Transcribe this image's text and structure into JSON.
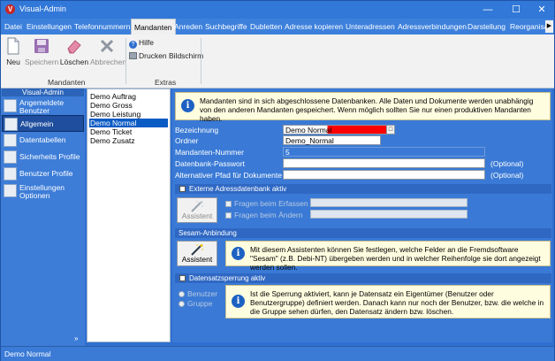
{
  "window": {
    "title": "Visual-Admin"
  },
  "menu": {
    "items": [
      "Datei",
      "Einstellungen",
      "Telefonnummern",
      "Mandanten",
      "Anreden",
      "Suchbegriffe",
      "Dubletten",
      "Adresse kopieren",
      "Unteradressen",
      "Adressverbindungen",
      "Darstellung",
      "Reorganisa"
    ],
    "active": "Mandanten"
  },
  "ribbon": {
    "neu": "Neu",
    "speichern": "Speichern",
    "loeschen": "Löschen",
    "abbrechen": "Abbrechen",
    "group_mandanten": "Mandanten",
    "hilfe": "Hilfe",
    "drucken": "Drucken Bildschirm",
    "group_extras": "Extras"
  },
  "sidebar": {
    "header": "Visual-Admin",
    "items": [
      {
        "label": "Angemeldete Benutzer",
        "icon": "users-icon"
      },
      {
        "label": "Allgemein",
        "icon": "general-icon"
      },
      {
        "label": "Datentabellen",
        "icon": "table-icon"
      },
      {
        "label": "Sicherheits Profile",
        "icon": "security-icon"
      },
      {
        "label": "Benutzer Profile",
        "icon": "user-profile-icon"
      },
      {
        "label": "Einstellungen Optionen",
        "icon": "settings-icon"
      }
    ],
    "active": "Allgemein"
  },
  "mandants": [
    "Demo Auftrag",
    "Demo Gross",
    "Demo Leistung",
    "Demo Normal",
    "Demo Ticket",
    "Demo Zusatz"
  ],
  "selected_mandant": "Demo Normal",
  "info": {
    "main": "Mandanten sind in sich abgeschlossene Datenbanken. Alle Daten und Dokumente werden unabhängig von den anderen Mandanten gespeichert. Wenn möglich sollten Sie nur einen produktiven Mandanten haben.",
    "sesam": "Mit diesem Assistenten können Sie festlegen, welche Felder an die Fremdsoftware \"Sesam\" (z.B. Debi-NT) übergeben werden und in welcher Reihenfolge sie dort angezeigt werden sollen.",
    "lock": "Ist die Sperrung aktiviert, kann je Datensatz ein Eigentümer (Benutzer oder Benutzergruppe) definiert werden. Danach kann nur noch der Benutzer, bzw. die welche in die Gruppe sehen dürfen, den Datensatz ändern bzw. löschen."
  },
  "form": {
    "bezeichnung_label": "Bezeichnung",
    "bezeichnung_value": "Demo Normal",
    "ordner_label": "Ordner",
    "ordner_value": "Demo_Normal",
    "nummer_label": "Mandanten-Nummer",
    "nummer_value": "5",
    "passwort_label": "Datenbank-Passwort",
    "passwort_value": "",
    "pfad_label": "Alternativer Pfad für Dokumente",
    "pfad_value": "",
    "optional": "(Optional)",
    "highlight_color": "#ff0000"
  },
  "extern": {
    "header": "Externe Adressdatenbank aktiv",
    "assistent": "Assistent",
    "erfassen": "Fragen beim Erfassen",
    "aendern": "Fragen beim Ändern"
  },
  "sesam": {
    "header": "Sesam-Anbindung",
    "assistent": "Assistent"
  },
  "lock": {
    "header": "Datensatzsperrung aktiv",
    "benutzer": "Benutzer",
    "gruppe": "Gruppe"
  },
  "status": {
    "text": "Demo Normal"
  }
}
